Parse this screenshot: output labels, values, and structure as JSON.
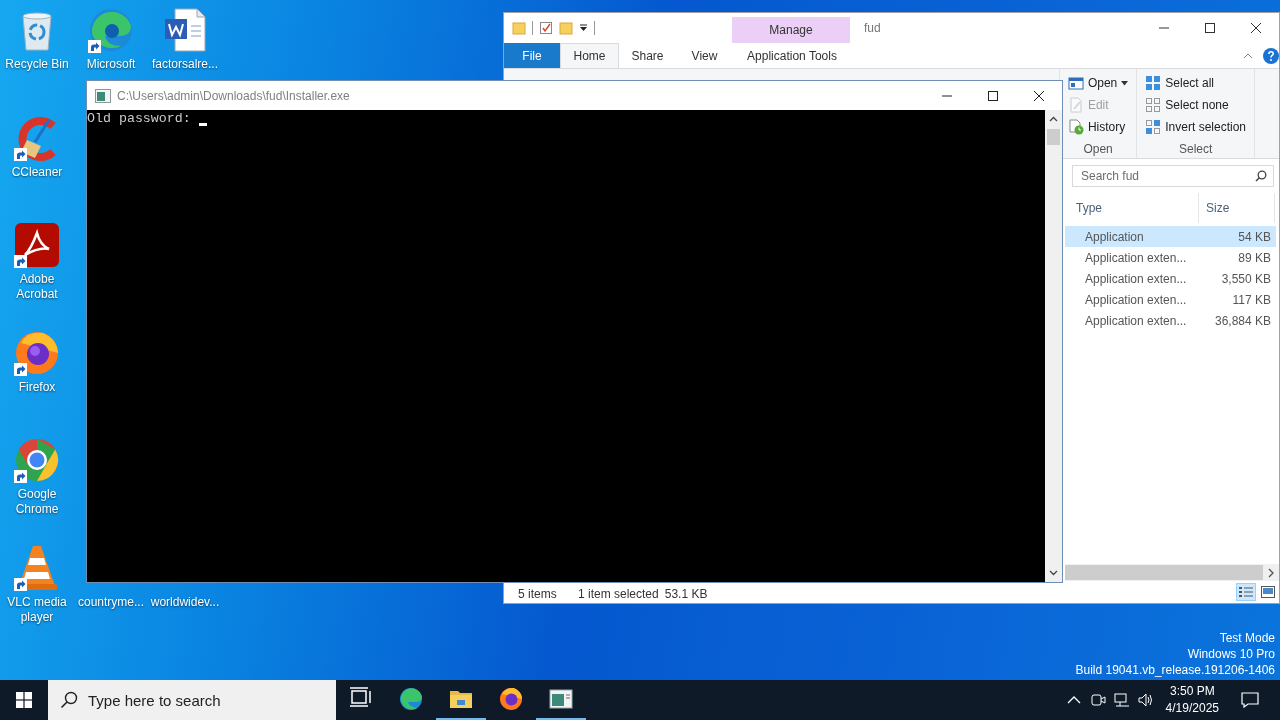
{
  "desktop_icons": [
    {
      "label": "Recycle Bin",
      "kind": "recycle-bin",
      "shortcut": false
    },
    {
      "label": "Microsoft",
      "kind": "edge",
      "shortcut": true
    },
    {
      "label": "factorsalre...",
      "kind": "word",
      "shortcut": false
    },
    {
      "label": "CCleaner",
      "kind": "ccleaner",
      "shortcut": true
    },
    {
      "label": "Adobe Acrobat",
      "kind": "acrobat",
      "shortcut": true
    },
    {
      "label": "Firefox",
      "kind": "firefox",
      "shortcut": true
    },
    {
      "label": "Google Chrome",
      "kind": "chrome",
      "shortcut": true
    },
    {
      "label": "VLC media player",
      "kind": "vlc",
      "shortcut": true
    },
    {
      "label": "countryme..."
    },
    {
      "label": "worldwidev..."
    }
  ],
  "explorer": {
    "title": "fud",
    "context_header": "Manage",
    "tabs": [
      {
        "label": "File",
        "kind": "file",
        "selected": false
      },
      {
        "label": "Home",
        "kind": "normal",
        "selected": true
      },
      {
        "label": "Share",
        "kind": "normal",
        "selected": false
      },
      {
        "label": "View",
        "kind": "normal",
        "selected": false
      },
      {
        "label": "Application Tools",
        "kind": "contextual",
        "selected": false
      }
    ],
    "ribbon_groups": [
      {
        "label": "Open",
        "commands": [
          {
            "label": "Open",
            "kind": "open",
            "dropdown": true,
            "disabled": false
          },
          {
            "label": "Edit",
            "kind": "edit",
            "dropdown": false,
            "disabled": true
          },
          {
            "label": "History",
            "kind": "history",
            "dropdown": false,
            "disabled": false
          }
        ]
      },
      {
        "label": "Select",
        "commands": [
          {
            "label": "Select all",
            "kind": "select-all",
            "dropdown": false,
            "disabled": false
          },
          {
            "label": "Select none",
            "kind": "select-none",
            "dropdown": false,
            "disabled": false
          },
          {
            "label": "Invert selection",
            "kind": "invert",
            "dropdown": false,
            "disabled": false
          }
        ]
      }
    ],
    "search": {
      "placeholder": "Search fud"
    },
    "columns": [
      "Type",
      "Size"
    ],
    "rows": [
      {
        "type": "Application",
        "size": "54 KB",
        "selected": true
      },
      {
        "type": "Application exten...",
        "size": "89 KB",
        "selected": false
      },
      {
        "type": "Application exten...",
        "size": "3,550 KB",
        "selected": false
      },
      {
        "type": "Application exten...",
        "size": "117 KB",
        "selected": false
      },
      {
        "type": "Application exten...",
        "size": "36,884 KB",
        "selected": false
      }
    ],
    "status": {
      "count": "5 items",
      "selection": "1 item selected",
      "selection_size": "53.1 KB"
    },
    "view_buttons": [
      {
        "kind": "details",
        "selected": true
      },
      {
        "kind": "large-icons",
        "selected": false
      }
    ]
  },
  "console": {
    "title": "C:\\Users\\admin\\Downloads\\fud\\Installer.exe",
    "prompt": "Old password: ",
    "cursor_visible": true
  },
  "os_info": [
    "Test Mode",
    "Windows 10 Pro",
    "Build 19041.vb_release.191206-1406"
  ],
  "taskbar": {
    "search_placeholder": "Type here to search",
    "items": [
      {
        "kind": "task-view",
        "running": false
      },
      {
        "kind": "edge",
        "running": false
      },
      {
        "kind": "explorer",
        "running": true
      },
      {
        "kind": "firefox",
        "running": false
      },
      {
        "kind": "console",
        "running": true
      }
    ],
    "time": "3:50 PM",
    "date": "4/19/2025"
  }
}
